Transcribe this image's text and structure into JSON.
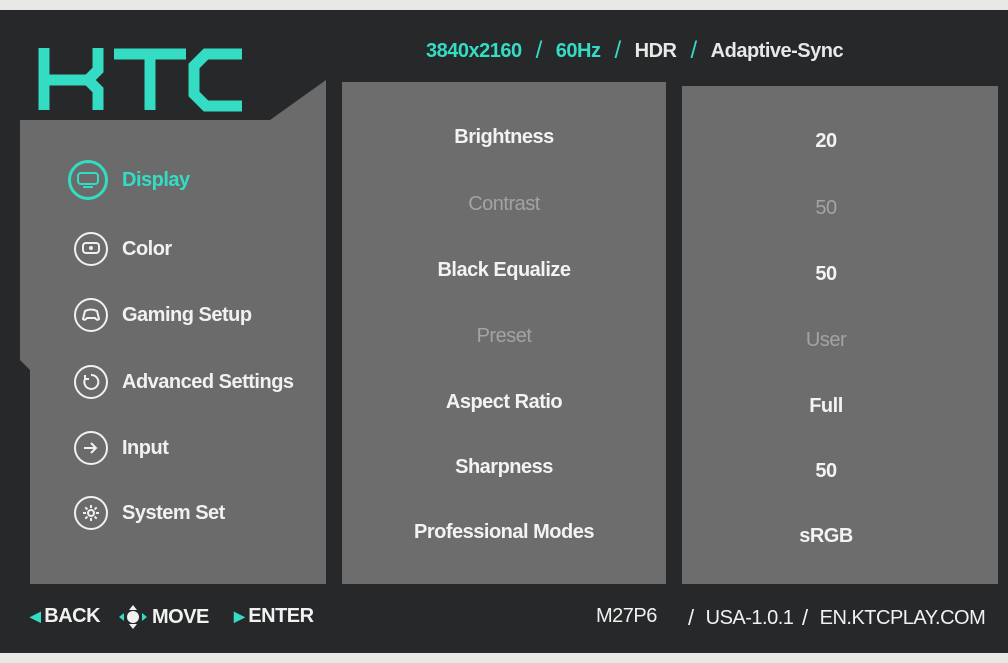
{
  "brand": {
    "logo_text": "KTC",
    "accent_color": "#34dcc4"
  },
  "status": {
    "resolution": "3840x2160",
    "refresh": "60Hz",
    "hdr": "HDR",
    "sync": "Adaptive-Sync"
  },
  "nav": {
    "items": [
      {
        "label": "Display",
        "icon": "monitor-icon",
        "active": true
      },
      {
        "label": "Color",
        "icon": "color-icon"
      },
      {
        "label": "Gaming Setup",
        "icon": "gamepad-icon"
      },
      {
        "label": "Advanced Settings",
        "icon": "advanced-settings-icon"
      },
      {
        "label": "Input",
        "icon": "input-icon"
      },
      {
        "label": "System Set",
        "icon": "gear-icon"
      }
    ]
  },
  "settings": {
    "rows": [
      {
        "label": "Brightness",
        "value": "20",
        "enabled": true
      },
      {
        "label": "Contrast",
        "value": "50",
        "enabled": false
      },
      {
        "label": "Black Equalize",
        "value": "50",
        "enabled": true
      },
      {
        "label": "Preset",
        "value": "User",
        "enabled": false
      },
      {
        "label": "Aspect Ratio",
        "value": "Full",
        "enabled": true
      },
      {
        "label": "Sharpness",
        "value": "50",
        "enabled": true
      },
      {
        "label": "Professional Modes",
        "value": "sRGB",
        "enabled": true
      }
    ]
  },
  "footer": {
    "back": "BACK",
    "move": "MOVE",
    "enter": "ENTER",
    "model": "M27P6",
    "firmware": "USA-1.0.1",
    "website": "EN.KTCPLAY.COM"
  }
}
